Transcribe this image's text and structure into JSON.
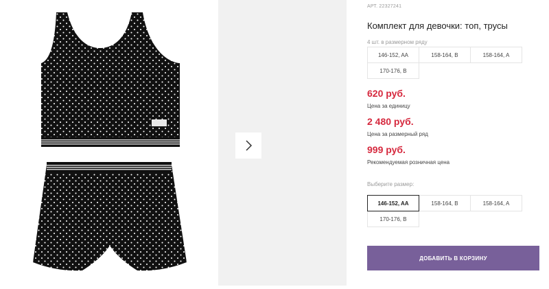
{
  "gallery": {
    "next_icon": "chevron-right-icon",
    "colors": {
      "fabric": "#111111",
      "dots": "#ffffff",
      "stripe": "#c8c8c8"
    }
  },
  "product": {
    "article": "АРТ. 22327241",
    "title": "Комплект для девочки: топ, трусы",
    "sizes_note": "4 шт. в размерном ряду",
    "sizes_in_pack": [
      "146-152, AA",
      "158-164, B",
      "158-164, A",
      "170-176, B"
    ],
    "prices": [
      {
        "value": "620 руб.",
        "note": "Цена за единицу"
      },
      {
        "value": "2 480 руб.",
        "note": "Цена за размерный ряд"
      },
      {
        "value": "999 руб.",
        "note": "Рекомендуемая розничная цена"
      }
    ],
    "price_color": "#d6293e",
    "choose_size_label": "Выберите размер:",
    "size_options": [
      "146-152, AA",
      "158-164, B",
      "158-164, A",
      "170-176, B"
    ],
    "selected_size": "146-152, AA",
    "add_to_cart_label": "ДОБАВИТЬ В КОРЗИНУ",
    "button_color": "#78609a"
  }
}
